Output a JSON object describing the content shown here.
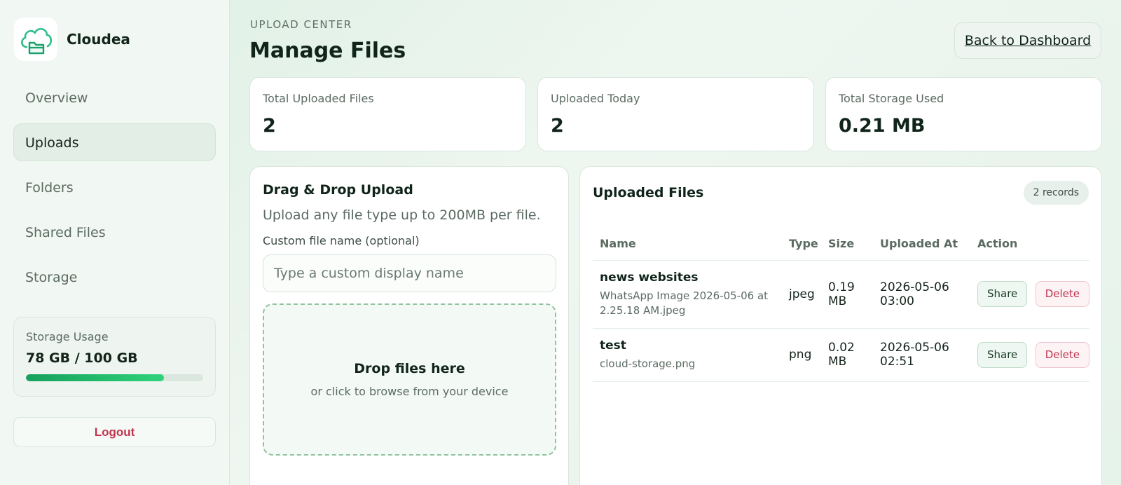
{
  "brand": {
    "name": "Cloudea",
    "logo_icon": "cloud-folder-icon"
  },
  "sidebar": {
    "nav": [
      {
        "label": "Overview",
        "active": false
      },
      {
        "label": "Uploads",
        "active": true
      },
      {
        "label": "Folders",
        "active": false
      },
      {
        "label": "Shared Files",
        "active": false
      },
      {
        "label": "Storage",
        "active": false
      }
    ],
    "storage": {
      "label": "Storage Usage",
      "value": "78 GB / 100 GB",
      "used_fraction": 0.78
    },
    "logout_label": "Logout"
  },
  "header": {
    "eyebrow": "UPLOAD CENTER",
    "title": "Manage Files",
    "back_label": "Back to Dashboard"
  },
  "stats": [
    {
      "label": "Total Uploaded Files",
      "value": "2"
    },
    {
      "label": "Uploaded Today",
      "value": "2"
    },
    {
      "label": "Total Storage Used",
      "value": "0.21 MB"
    }
  ],
  "upload": {
    "title": "Drag & Drop Upload",
    "description": "Upload any file type up to 200MB per file.",
    "field_label": "Custom file name (optional)",
    "field_placeholder": "Type a custom display name",
    "field_value": "",
    "drop_title": "Drop files here",
    "drop_subtitle": "or click to browse from your device"
  },
  "files": {
    "title": "Uploaded Files",
    "records_badge": "2 records",
    "columns": [
      "Name",
      "Type",
      "Size",
      "Uploaded At",
      "Action"
    ],
    "rows": [
      {
        "name": "news websites",
        "original": "WhatsApp Image 2026-05-06 at 2.25.18 AM.jpeg",
        "type": "jpeg",
        "size": "0.19 MB",
        "uploaded_at": "2026-05-06 03:00",
        "share_label": "Share",
        "delete_label": "Delete"
      },
      {
        "name": "test",
        "original": "cloud-storage.png",
        "type": "png",
        "size": "0.02 MB",
        "uploaded_at": "2026-05-06 02:51",
        "share_label": "Share",
        "delete_label": "Delete"
      }
    ]
  },
  "colors": {
    "accent": "#16a05c",
    "danger": "#c0344f",
    "text": "#13231a",
    "muted": "#5b6b62"
  }
}
